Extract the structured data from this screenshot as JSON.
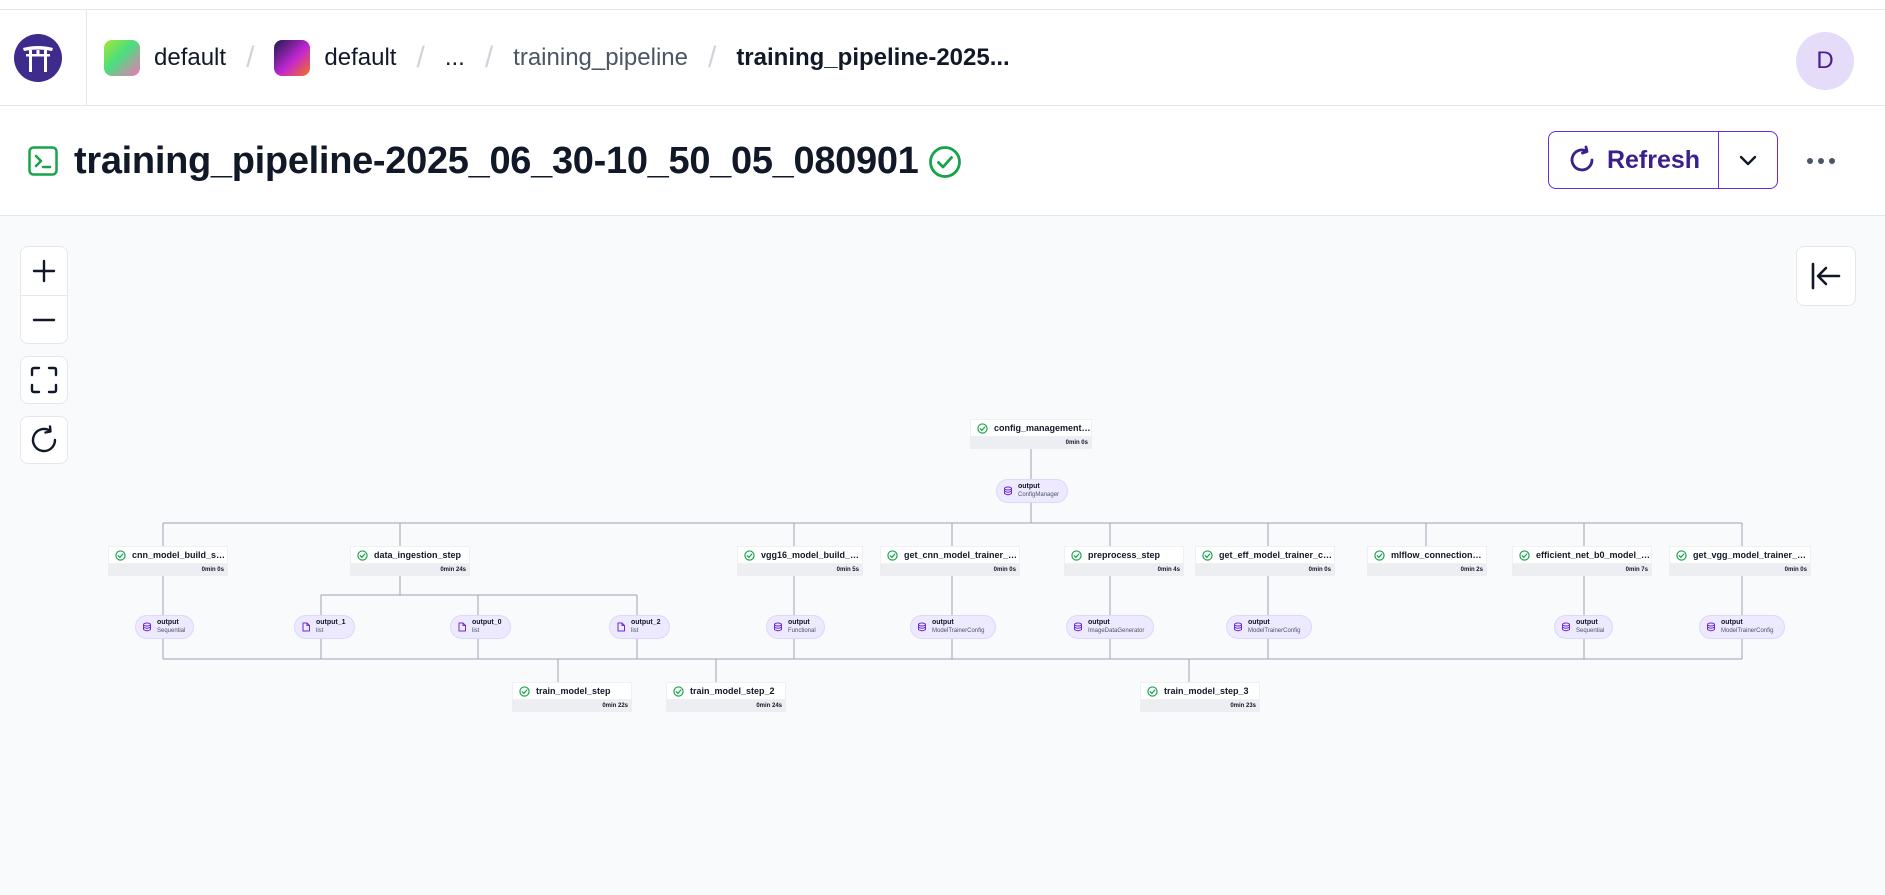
{
  "header": {
    "breadcrumbs": [
      "default",
      "default",
      "...",
      "training_pipeline",
      "training_pipeline-2025..."
    ],
    "avatar_initial": "D"
  },
  "run": {
    "title": "training_pipeline-2025_06_30-10_50_05_080901",
    "status": "completed",
    "refresh_label": "Refresh"
  },
  "colors": {
    "accent": "#6d28d9",
    "success": "#16a34a",
    "artifact_bg": "#ede9fe"
  },
  "graph": {
    "steps": [
      {
        "id": "config",
        "name": "config_management_step",
        "duration": "0min 0s"
      },
      {
        "id": "cnn",
        "name": "cnn_model_build_step",
        "duration": "0min 0s"
      },
      {
        "id": "ingest",
        "name": "data_ingestion_step",
        "duration": "0min 24s"
      },
      {
        "id": "vgg",
        "name": "vgg16_model_build_step",
        "duration": "0min 5s"
      },
      {
        "id": "getcnn",
        "name": "get_cnn_model_trainer_confi...",
        "duration": "0min 0s"
      },
      {
        "id": "pre",
        "name": "preprocess_step",
        "duration": "0min 4s"
      },
      {
        "id": "geteff",
        "name": "get_eff_model_trainer_config...",
        "duration": "0min 0s"
      },
      {
        "id": "mlflow",
        "name": "mlflow_connection_step",
        "duration": "0min 2s"
      },
      {
        "id": "eff",
        "name": "efficient_net_b0_model_build...",
        "duration": "0min 7s"
      },
      {
        "id": "getvgg",
        "name": "get_vgg_model_trainer_confi...",
        "duration": "0min 0s"
      },
      {
        "id": "t1",
        "name": "train_model_step",
        "duration": "0min 22s"
      },
      {
        "id": "t2",
        "name": "train_model_step_2",
        "duration": "0min 24s"
      },
      {
        "id": "t3",
        "name": "train_model_step_3",
        "duration": "0min 23s"
      }
    ],
    "artifacts": [
      {
        "id": "a_cfg",
        "name": "output",
        "type": "ConfigManager",
        "kind": "model"
      },
      {
        "id": "a_cnn",
        "name": "output",
        "type": "Sequential",
        "kind": "model"
      },
      {
        "id": "a_o1",
        "name": "output_1",
        "type": "list",
        "kind": "file"
      },
      {
        "id": "a_o0",
        "name": "output_0",
        "type": "list",
        "kind": "file"
      },
      {
        "id": "a_o2",
        "name": "output_2",
        "type": "list",
        "kind": "file"
      },
      {
        "id": "a_vgg",
        "name": "output",
        "type": "Functional",
        "kind": "model"
      },
      {
        "id": "a_getcnn",
        "name": "output",
        "type": "ModelTrainerConfig",
        "kind": "model"
      },
      {
        "id": "a_pre",
        "name": "output",
        "type": "ImageDataGenerator",
        "kind": "model"
      },
      {
        "id": "a_geteff",
        "name": "output",
        "type": "ModelTrainerConfig",
        "kind": "model"
      },
      {
        "id": "a_eff",
        "name": "output",
        "type": "Sequential",
        "kind": "model"
      },
      {
        "id": "a_getvgg",
        "name": "output",
        "type": "ModelTrainerConfig",
        "kind": "model"
      }
    ]
  }
}
